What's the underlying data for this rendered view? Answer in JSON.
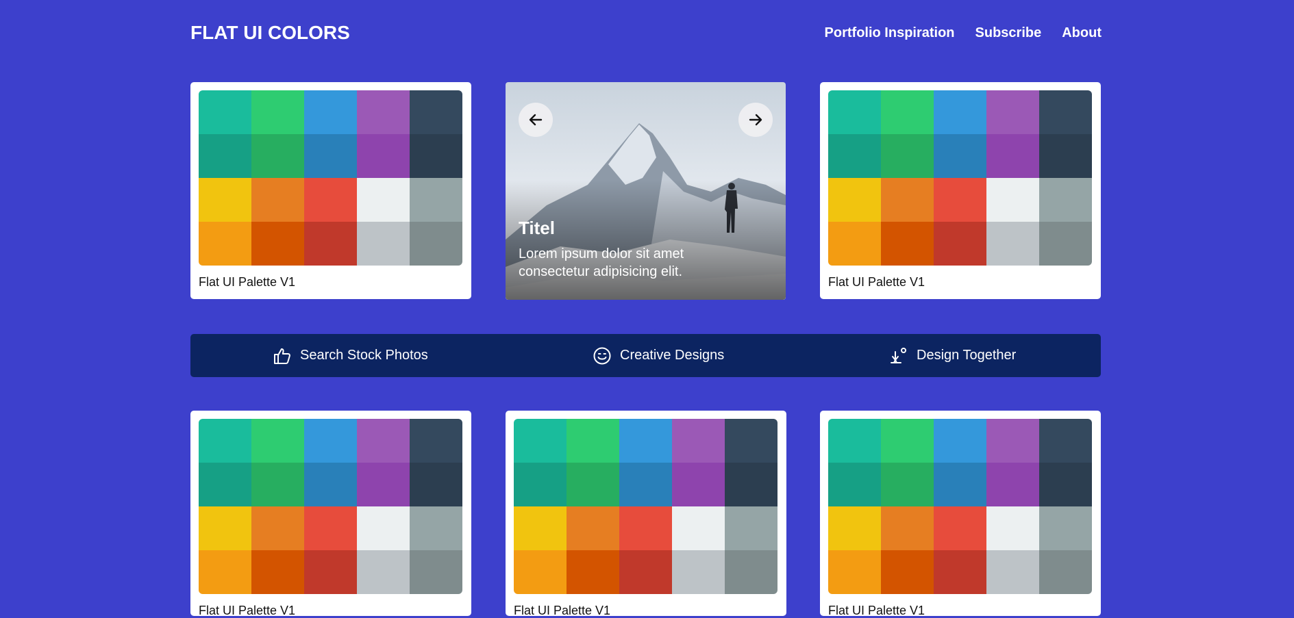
{
  "header": {
    "logo": "FLAT UI COLORS",
    "nav": [
      "Portfolio Inspiration",
      "Subscribe",
      "About"
    ]
  },
  "palette_colors": [
    "#1abc9c",
    "#2ecc71",
    "#3498db",
    "#9b59b6",
    "#34495e",
    "#16a085",
    "#27ae60",
    "#2980b9",
    "#8e44ad",
    "#2c3e50",
    "#f1c40f",
    "#e67e22",
    "#e74c3c",
    "#ecf0f1",
    "#95a5a6",
    "#f39c12",
    "#d35400",
    "#c0392b",
    "#bdc3c7",
    "#7f8c8d"
  ],
  "cards": {
    "card1": {
      "label": "Flat UI Palette V1"
    },
    "card2": {
      "label": "Flat UI Palette V1"
    },
    "card3": {
      "label": "Flat UI Palette V1"
    },
    "card4": {
      "label": "Flat UI Palette V1"
    },
    "card5": {
      "label": "Flat UI Palette V1"
    }
  },
  "slider": {
    "title": "Titel",
    "text": "Lorem ipsum dolor sit amet consectetur adipisicing elit.",
    "prev_icon": "arrow-left-icon",
    "next_icon": "arrow-right-icon"
  },
  "features": [
    {
      "label": "Search Stock Photos",
      "icon": "thumbs-up-icon"
    },
    {
      "label": "Creative Designs",
      "icon": "smile-icon"
    },
    {
      "label": "Design Together",
      "icon": "plant-icon"
    }
  ],
  "colors": {
    "background": "#3d40cc",
    "feature_bar": "#0c2461",
    "card": "#ffffff"
  }
}
